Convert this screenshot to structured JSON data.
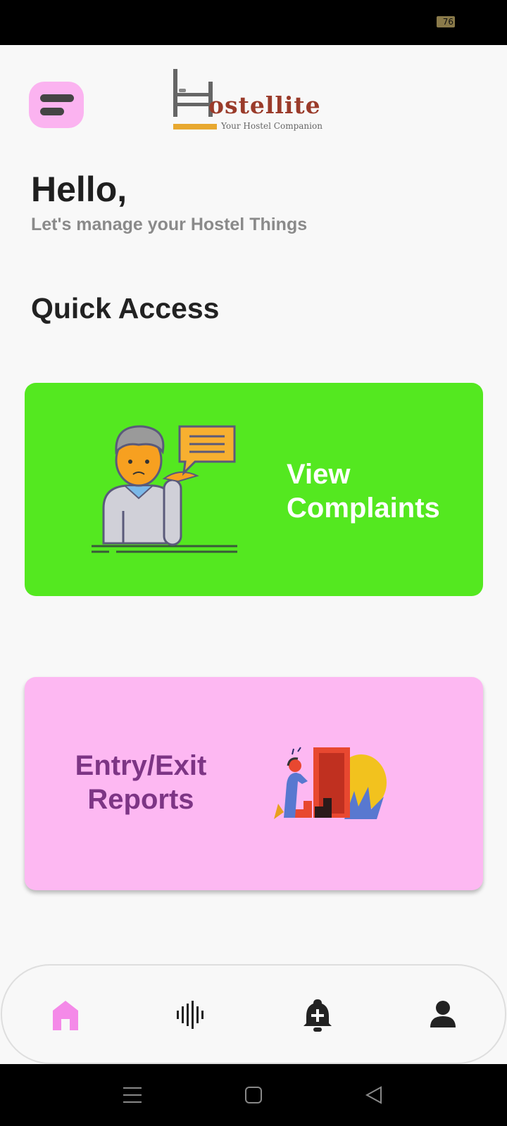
{
  "status_bar": {
    "battery": "76"
  },
  "header": {
    "menu_icon": "menu-icon",
    "logo_text": "ostellite",
    "logo_tagline": "Your Hostel Companion"
  },
  "greeting": {
    "title": "Hello,",
    "subtitle": "Let's manage your Hostel Things"
  },
  "section_title": "Quick Access",
  "cards": [
    {
      "title_line1": "View",
      "title_line2": "Complaints",
      "color": "#54e820",
      "text_color": "#ffffff",
      "icon": "complaint-person-icon"
    },
    {
      "title_line1": "Entry/Exit",
      "title_line2": "Reports",
      "color": "#fdb8f2",
      "text_color": "#7d3585",
      "icon": "exit-door-icon"
    }
  ],
  "bottom_nav": {
    "items": [
      {
        "icon": "home-icon",
        "active": true
      },
      {
        "icon": "waveform-icon",
        "active": false
      },
      {
        "icon": "add-alert-icon",
        "active": false
      },
      {
        "icon": "person-icon",
        "active": false
      }
    ],
    "active_color": "#f48ae8"
  },
  "system_nav": [
    "menu-icon",
    "home-square-icon",
    "back-triangle-icon"
  ]
}
